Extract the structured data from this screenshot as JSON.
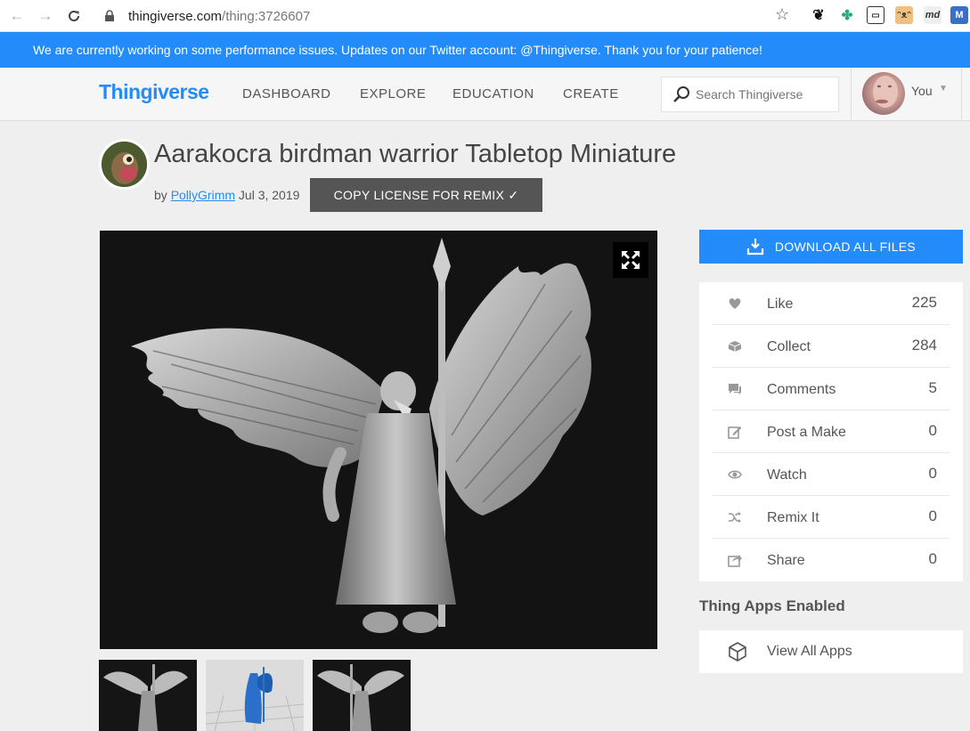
{
  "browser": {
    "url_host": "thingiverse.com",
    "url_path": "/thing:3726607"
  },
  "announcement": "We are currently working on some performance issues. Updates on our Twitter account: @Thingiverse. Thank you for your patience!",
  "header": {
    "logo": "Thingiverse",
    "nav": [
      "DASHBOARD",
      "EXPLORE",
      "EDUCATION",
      "CREATE"
    ],
    "search_placeholder": "Search Thingiverse",
    "user_label": "You"
  },
  "thing": {
    "title": "Aarakocra birdman warrior Tabletop Miniature",
    "by": "by",
    "author": "PollyGrimm",
    "date": "Jul 3, 2019",
    "copy_license": "COPY LICENSE FOR REMIX ✓"
  },
  "sidebar": {
    "download_label": "DOWNLOAD ALL FILES",
    "stats": [
      {
        "label": "Like",
        "count": "225",
        "icon": "heart-icon"
      },
      {
        "label": "Collect",
        "count": "284",
        "icon": "collect-icon"
      },
      {
        "label": "Comments",
        "count": "5",
        "icon": "comments-icon"
      },
      {
        "label": "Post a Make",
        "count": "0",
        "icon": "post-make-icon"
      },
      {
        "label": "Watch",
        "count": "0",
        "icon": "eye-icon"
      },
      {
        "label": "Remix It",
        "count": "0",
        "icon": "shuffle-icon"
      },
      {
        "label": "Share",
        "count": "0",
        "icon": "share-icon"
      }
    ],
    "apps_heading": "Thing Apps Enabled",
    "apps_link": "View All Apps"
  },
  "colors": {
    "accent": "#248bfb",
    "license_button": "#555555",
    "image_bg": "#131313"
  }
}
